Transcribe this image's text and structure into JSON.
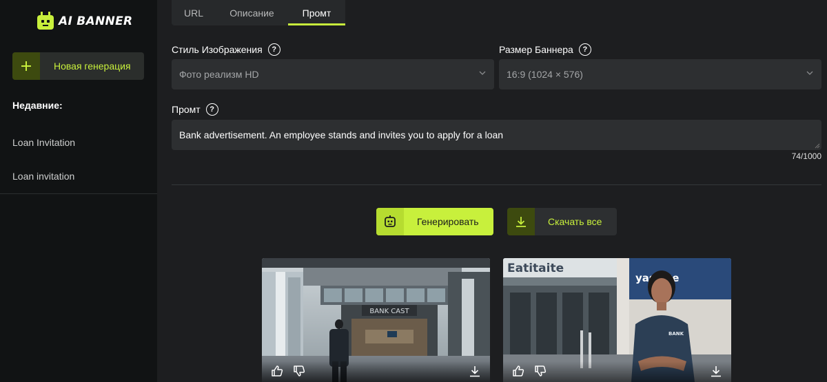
{
  "app": {
    "logo_text": "AI BANNER",
    "accent_color": "#c8f03c"
  },
  "sidebar": {
    "new_generation_label": "Новая генерация",
    "recent_title": "Недавние:",
    "recent_items": [
      {
        "label": "Loan Invitation"
      },
      {
        "label": "Loan invitation"
      }
    ]
  },
  "tabs": [
    {
      "label": "URL",
      "active": false
    },
    {
      "label": "Описание",
      "active": false
    },
    {
      "label": "Промт",
      "active": true
    }
  ],
  "form": {
    "image_style": {
      "label": "Стиль Изображения",
      "value": "Фото реализм HD"
    },
    "banner_size": {
      "label": "Размер Баннера",
      "value": "16:9 (1024 × 576)"
    },
    "prompt": {
      "label": "Промт",
      "value": "Bank advertisement. An employee stands and invites you to apply for a loan",
      "counter": "74/1000"
    }
  },
  "actions": {
    "generate_label": "Генерировать",
    "download_all_label": "Скачать все"
  },
  "results": [
    {
      "sign_text": "BANK CAST",
      "icons": [
        "thumbs-up-icon",
        "thumbs-down-icon",
        "download-icon"
      ]
    },
    {
      "sign_text": "yasatte",
      "top_sign_text": "Eatitaite",
      "shirt_text": "BANK",
      "icons": [
        "thumbs-up-icon",
        "thumbs-down-icon",
        "download-icon"
      ]
    }
  ]
}
